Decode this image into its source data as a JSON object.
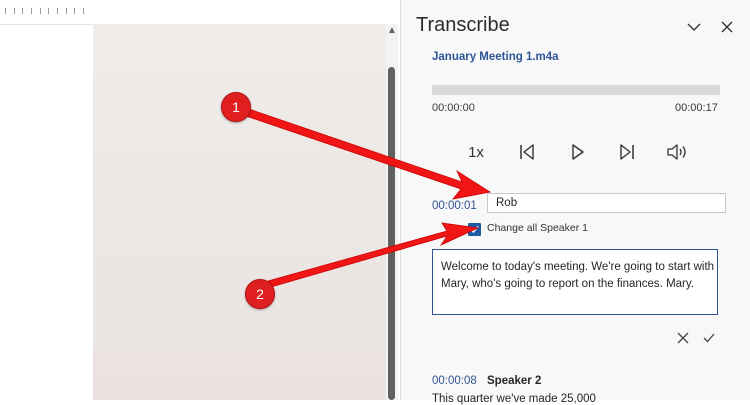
{
  "panel": {
    "title": "Transcribe",
    "file_name": "January Meeting 1.m4a",
    "time_start": "00:00:00",
    "time_end": "00:00:17",
    "speed": "1x",
    "progress_fraction": 0
  },
  "edit": {
    "timestamp": "00:00:01",
    "speaker_name": "Rob",
    "change_all_label": "Change all Speaker 1",
    "change_all_checked": true,
    "text": "Welcome to today's meeting. We're going to start with Mary, who's going to report on the finances. Mary."
  },
  "next_entry": {
    "timestamp": "00:00:08",
    "speaker": "Speaker 2",
    "text": "This quarter we've made 25,000"
  },
  "annotations": [
    {
      "label": "1"
    },
    {
      "label": "2"
    }
  ],
  "colors": {
    "accent": "#2f5597",
    "annotation_red": "#e02020",
    "checkbox_blue": "#1f5aa6"
  }
}
